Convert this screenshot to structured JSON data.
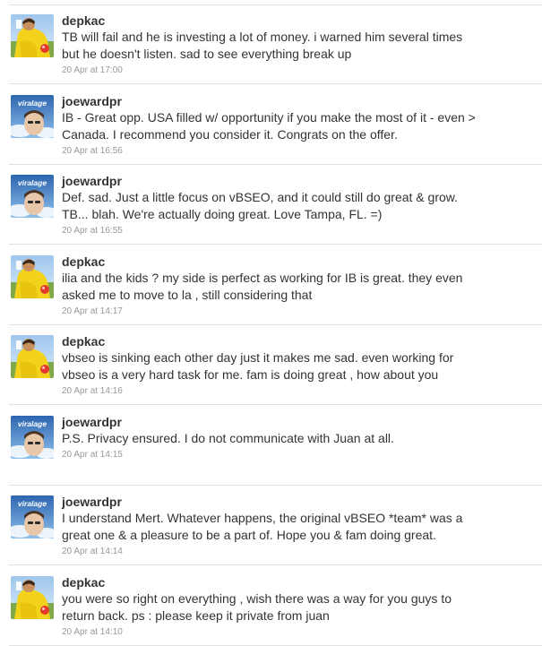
{
  "feed": {
    "tweets": [
      {
        "user": "depkac",
        "avatar": "depkac-avatar",
        "lines": [
          "TB will fail and he is investing a lot of money. i warned him several times",
          "but he doesn't listen. sad to see everything break up"
        ],
        "time": "20 Apr at 17:00"
      },
      {
        "user": "joewardpr",
        "avatar": "viralage-avatar",
        "lines": [
          "IB - Great opp. USA filled w/ opportunity if you make the most of it - even >",
          "Canada. I recommend you consider it. Congrats on the offer."
        ],
        "time": "20 Apr at 16:56"
      },
      {
        "user": "joewardpr",
        "avatar": "viralage-avatar",
        "lines": [
          "Def. sad. Just a little focus on vBSEO, and it could still do great & grow.",
          "TB... blah. We're actually doing great. Love Tampa, FL. =)"
        ],
        "time": "20 Apr at 16:55"
      },
      {
        "user": "depkac",
        "avatar": "depkac-avatar",
        "lines": [
          "ilia and the kids ? my side is perfect as working for IB is great. they even",
          "asked me to move to la , still considering that"
        ],
        "time": "20 Apr at 14:17"
      },
      {
        "user": "depkac",
        "avatar": "depkac-avatar",
        "lines": [
          "vbseo is sinking each other day just it makes me sad. even working for",
          "vbseo is a very hard task for me. fam is doing great , how about you"
        ],
        "time": "20 Apr at 14:16"
      },
      {
        "user": "joewardpr",
        "avatar": "viralage-avatar",
        "lines": [
          "P.S. Privacy ensured. I do not communicate with Juan at all."
        ],
        "time": "20 Apr at 14:15"
      },
      {
        "user": "joewardpr",
        "avatar": "viralage-avatar",
        "lines": [
          "I understand Mert. Whatever happens, the original vBSEO *team* was a",
          "great one & a pleasure to be a part of. Hope you & fam doing great."
        ],
        "time": "20 Apr at 14:14"
      },
      {
        "user": "depkac",
        "avatar": "depkac-avatar",
        "lines": [
          "you were so right on everything , wish there was a way for you guys to",
          "return back. ps : please keep it private from juan"
        ],
        "time": "20 Apr at 14:10"
      }
    ],
    "viralage_logo_text": "viralage",
    "colors": {
      "text": "#333333",
      "timestamp": "#999999",
      "divider": "#e2e2e2",
      "viralage_sky": "#4d86c6",
      "depkac_sky": "#7fb4e6"
    }
  }
}
